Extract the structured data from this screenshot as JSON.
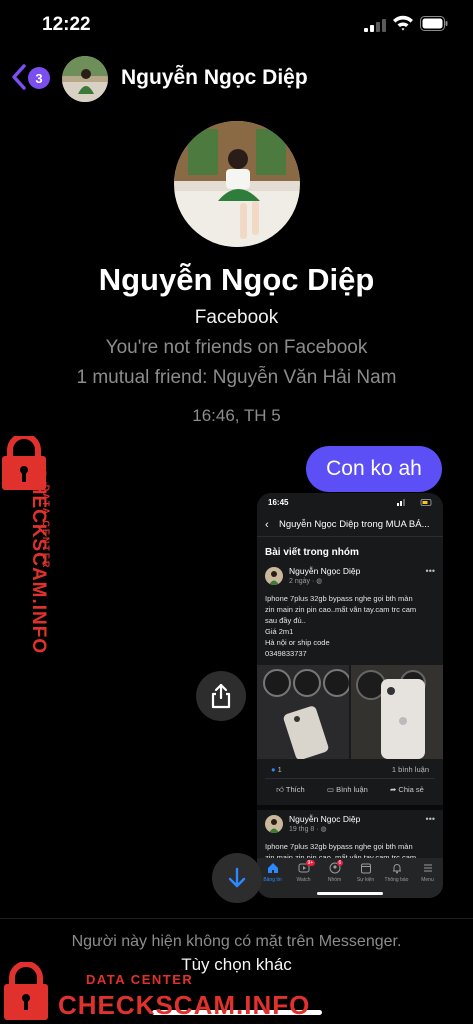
{
  "status_bar": {
    "time": "12:22"
  },
  "header": {
    "unread_badge": "3",
    "contact_name": "Nguyễn Ngọc Diệp"
  },
  "profile": {
    "name": "Nguyễn Ngọc Diệp",
    "platform": "Facebook",
    "friend_status": "You're not friends on Facebook",
    "mutual": "1 mutual friend: Nguyễn Văn Hải Nam"
  },
  "conversation": {
    "timestamp": "16:46, TH 5",
    "messages": [
      {
        "from": "me",
        "text": "Con ko ah"
      }
    ]
  },
  "shared_screenshot": {
    "time": "16:45",
    "nav_title": "Nguyễn Ngọc Diệp trong MUA BÁ...",
    "section": "Bài viết trong nhóm",
    "post1": {
      "author": "Nguyễn Ngọc Diệp",
      "date": "2 ngày · ",
      "lines": [
        "Iphone 7plus 32gb bypass nghe gọi bth màn",
        "zin main zin pin cao..mất vân tay.cam trc cam",
        "sau đầy đủ..",
        "Giá 2m1",
        "Hà nội or ship code",
        "0349833737"
      ],
      "reactions": "1",
      "comments": "1 bình luận",
      "actions": {
        "like": "Thích",
        "comment": "Bình luận",
        "share": "Chia sẻ"
      }
    },
    "post2": {
      "author": "Nguyễn Ngọc Diệp",
      "date": "19 thg 8 · ",
      "lines": [
        "Iphone 7plus 32gb bypass nghe gọi bth màn",
        "zin main zin pin cao..mất vân tay.cam trc cam"
      ]
    },
    "tabs": [
      {
        "label": "Bảng tin",
        "badge": ""
      },
      {
        "label": "Watch",
        "badge": "9+"
      },
      {
        "label": "Nhóm",
        "badge": "6"
      },
      {
        "label": "Sự kiện",
        "badge": ""
      },
      {
        "label": "Thông báo",
        "badge": ""
      },
      {
        "label": "Menu",
        "badge": ""
      }
    ]
  },
  "footer": {
    "notice": "Người này hiện không có mặt trên Messenger.",
    "options_link": "Tùy chọn khác"
  },
  "watermark": {
    "sub": "DATA CENTER",
    "title": "CHECKSCAM.INFO"
  },
  "colors": {
    "accent": "#5b4ff5",
    "badge": "#7a4ef0",
    "watermark": "#e0312d",
    "fb_blue": "#2d88ff"
  }
}
